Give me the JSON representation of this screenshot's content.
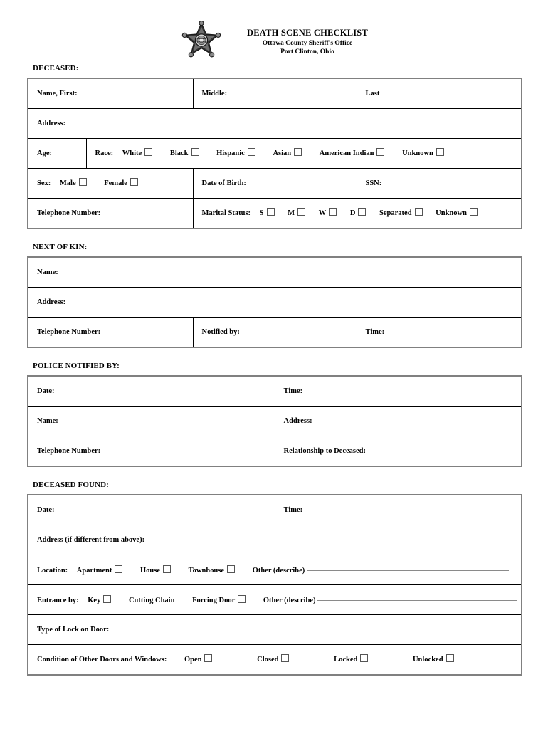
{
  "header": {
    "badge_icon": "sheriff-star-badge-icon",
    "title": "DEATH SCENE CHECKLIST",
    "subtitle_1": "Ottawa County Sheriff's Office",
    "subtitle_2": "Port Clinton, Ohio"
  },
  "sections": {
    "deceased": {
      "label": "DECEASED:",
      "name_first": "Name, First:",
      "name_middle": "Middle:",
      "name_last": "Last",
      "address": "Address:",
      "age": "Age:",
      "race_label": "Race:",
      "race_options": [
        "White",
        "Black",
        "Hispanic",
        "Asian",
        "American Indian",
        "Unknown"
      ],
      "sex_label": "Sex:",
      "sex_options": [
        "Male",
        "Female"
      ],
      "dob": "Date of Birth:",
      "ssn": "SSN:",
      "telephone": "Telephone Number:",
      "marital_label": "Marital Status:",
      "marital_options": [
        "S",
        "M",
        "W",
        "D",
        "Separated",
        "Unknown"
      ]
    },
    "next_of_kin": {
      "label": "NEXT OF KIN:",
      "name": "Name:",
      "address": "Address:",
      "telephone": "Telephone Number:",
      "notified_by": "Notified by:",
      "time": "Time:"
    },
    "police_notified_by": {
      "label": "POLICE NOTIFIED BY:",
      "date": "Date:",
      "time": "Time:",
      "name": "Name:",
      "address": "Address:",
      "telephone": "Telephone Number:",
      "relationship": "Relationship to Deceased:"
    },
    "deceased_found": {
      "label": "DECEASED FOUND:",
      "date": "Date:",
      "time": "Time:",
      "address": "Address (if different from above):",
      "location_label": "Location:",
      "location_options": [
        "Apartment",
        "House",
        "Townhouse"
      ],
      "location_other": "Other (describe)",
      "entrance_label": "Entrance by:",
      "entrance_options": [
        "Key",
        "Forcing Door"
      ],
      "entrance_nocheck": "Cutting Chain",
      "entrance_other": "Other (describe)",
      "lock_type": "Type of Lock on Door:",
      "condition_label": "Condition of Other Doors and Windows:",
      "condition_options": [
        "Open",
        "Closed",
        "Locked",
        "Unlocked"
      ]
    }
  },
  "colors": {
    "outer_border": "#808080",
    "inner_border": "#000000",
    "fill_line": "#8a8a8a",
    "text": "#000000"
  }
}
